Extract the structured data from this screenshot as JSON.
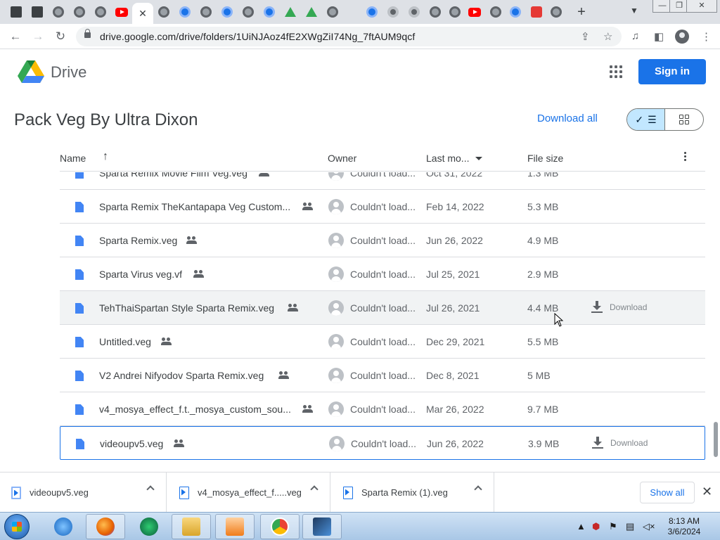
{
  "browser": {
    "tabs": [
      {
        "icon": "archive-icon",
        "active": false
      },
      {
        "icon": "archive-icon",
        "active": false
      },
      {
        "icon": "globe-icon",
        "active": false
      },
      {
        "icon": "globe-icon",
        "active": false
      },
      {
        "icon": "globe-icon",
        "active": false
      },
      {
        "icon": "youtube-icon",
        "active": false
      },
      {
        "icon": "close-icon",
        "active": true
      },
      {
        "icon": "globe-icon",
        "active": false
      },
      {
        "icon": "edge-icon",
        "active": false
      },
      {
        "icon": "globe-icon",
        "active": false
      },
      {
        "icon": "edge-icon",
        "active": false
      },
      {
        "icon": "globe-icon",
        "active": false
      },
      {
        "icon": "edge-icon",
        "active": false
      },
      {
        "icon": "google-drive-icon",
        "active": false
      },
      {
        "icon": "google-drive-icon",
        "active": false
      },
      {
        "icon": "globe-icon",
        "active": false
      },
      {
        "icon": "edge-icon",
        "active": false
      },
      {
        "icon": "chrome-icon",
        "active": false
      },
      {
        "icon": "chrome-icon",
        "active": false
      },
      {
        "icon": "globe-icon",
        "active": false
      },
      {
        "icon": "globe-icon",
        "active": false
      },
      {
        "icon": "youtube-icon",
        "active": false
      },
      {
        "icon": "globe-icon",
        "active": false
      },
      {
        "icon": "edge-icon",
        "active": false
      },
      {
        "icon": "download-site-icon",
        "active": false
      },
      {
        "icon": "globe-icon",
        "active": false
      }
    ],
    "url": "drive.google.com/drive/folders/1UiNJAoz4fE2XWgZiI74Ng_7ftAUM9qcf"
  },
  "drive": {
    "app_name": "Drive",
    "sign_in_label": "Sign in",
    "folder_title": "Pack Veg By Ultra Dixon",
    "download_all_label": "Download all",
    "columns": {
      "name": "Name",
      "owner": "Owner",
      "last_modified": "Last mo...",
      "file_size": "File size"
    },
    "files": [
      {
        "name": "Sparta Remix Movie Film Veg.veg",
        "owner": "Couldn't load...",
        "modified": "Oct 31, 2022",
        "size": "1.3 MB"
      },
      {
        "name": "Sparta Remix TheKantapapa Veg Custom...",
        "owner": "Couldn't load...",
        "modified": "Feb 14, 2022",
        "size": "5.3 MB"
      },
      {
        "name": "Sparta Remix.veg",
        "owner": "Couldn't load...",
        "modified": "Jun 26, 2022",
        "size": "4.9 MB"
      },
      {
        "name": "Sparta Virus veg.vf",
        "owner": "Couldn't load...",
        "modified": "Jul 25, 2021",
        "size": "2.9 MB"
      },
      {
        "name": "TehThaiSpartan Style Sparta Remix.veg",
        "owner": "Couldn't load...",
        "modified": "Jul 26, 2021",
        "size": "4.4 MB",
        "download_label": "Download",
        "state": "hover"
      },
      {
        "name": "Untitled.veg",
        "owner": "Couldn't load...",
        "modified": "Dec 29, 2021",
        "size": "5.5 MB"
      },
      {
        "name": "V2 Andrei Nifyodov Sparta Remix.veg",
        "owner": "Couldn't load...",
        "modified": "Dec 8, 2021",
        "size": "5 MB"
      },
      {
        "name": "v4_mosya_effect_f.t._mosya_custom_sou...",
        "owner": "Couldn't load...",
        "modified": "Mar 26, 2022",
        "size": "9.7 MB"
      },
      {
        "name": "videoupv5.veg",
        "owner": "Couldn't load...",
        "modified": "Jun 26, 2022",
        "size": "3.9 MB",
        "download_label": "Download",
        "state": "selected"
      }
    ]
  },
  "downloads_shelf": {
    "items": [
      {
        "name": "videoupv5.veg"
      },
      {
        "name": "v4_mosya_effect_f.....veg"
      },
      {
        "name": "Sparta Remix (1).veg"
      }
    ],
    "show_all_label": "Show all"
  },
  "taskbar": {
    "apps": [
      "internet-explorer-icon",
      "firefox-icon",
      "app-icon",
      "file-explorer-icon",
      "media-player-icon",
      "chrome-icon",
      "video-editor-icon"
    ],
    "time": "8:13 AM",
    "date": "3/6/2024"
  },
  "colors": {
    "accent": "#1a73e8",
    "selected_toggle": "#c2e7ff",
    "file_icon": "#4285f4",
    "hover_row": "#f1f3f4"
  }
}
